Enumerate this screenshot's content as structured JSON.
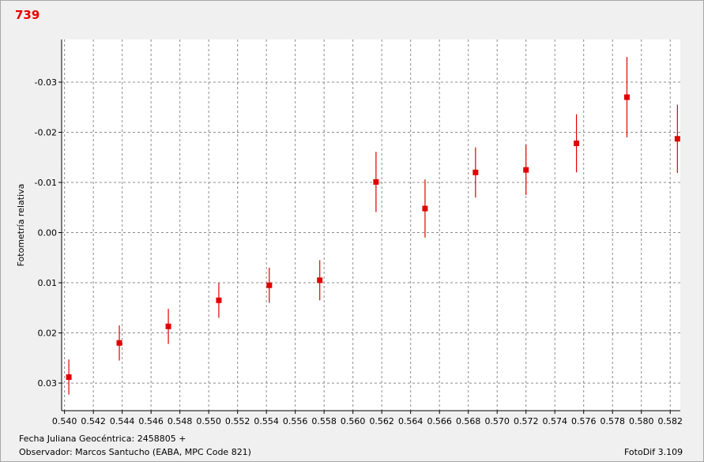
{
  "chart_data": {
    "type": "scatter",
    "title": "739",
    "ylabel": "Fotometría relativa",
    "xlabel": "Fecha Juliana Geocéntrica: 2458805 +",
    "x_ticks": [
      "0.540",
      "0.542",
      "0.544",
      "0.546",
      "0.548",
      "0.550",
      "0.552",
      "0.554",
      "0.556",
      "0.558",
      "0.560",
      "0.562",
      "0.564",
      "0.566",
      "0.568",
      "0.570",
      "0.572",
      "0.574",
      "0.576",
      "0.578",
      "0.580",
      "0.582"
    ],
    "y_ticks": [
      "-0.03",
      "-0.02",
      "-0.01",
      "0.00",
      "0.01",
      "0.02",
      "0.03"
    ],
    "xlim": [
      0.5398,
      0.5827
    ],
    "ylim": [
      -0.0385,
      0.0355
    ],
    "y_inverted": true,
    "grid": true,
    "marker_color": "#e00000",
    "points": [
      {
        "x": 0.5403,
        "y": 0.0288,
        "err": 0.0035
      },
      {
        "x": 0.5438,
        "y": 0.022,
        "err": 0.0035
      },
      {
        "x": 0.5472,
        "y": 0.0187,
        "err": 0.0035
      },
      {
        "x": 0.5507,
        "y": 0.0135,
        "err": 0.0035
      },
      {
        "x": 0.5542,
        "y": 0.0105,
        "err": 0.0035
      },
      {
        "x": 0.5577,
        "y": 0.0095,
        "err": 0.004
      },
      {
        "x": 0.5616,
        "y": -0.0101,
        "err": 0.006
      },
      {
        "x": 0.565,
        "y": -0.0048,
        "err": 0.0058
      },
      {
        "x": 0.5685,
        "y": -0.012,
        "err": 0.005
      },
      {
        "x": 0.572,
        "y": -0.0125,
        "err": 0.005
      },
      {
        "x": 0.5755,
        "y": -0.0178,
        "err": 0.0058
      },
      {
        "x": 0.579,
        "y": -0.027,
        "err": 0.008
      },
      {
        "x": 0.5825,
        "y": -0.0187,
        "err": 0.0068
      }
    ]
  },
  "footer": {
    "observer": "Observador: Marcos Santucho (EABA, MPC Code 821)",
    "software": "FotoDif 3.109"
  }
}
